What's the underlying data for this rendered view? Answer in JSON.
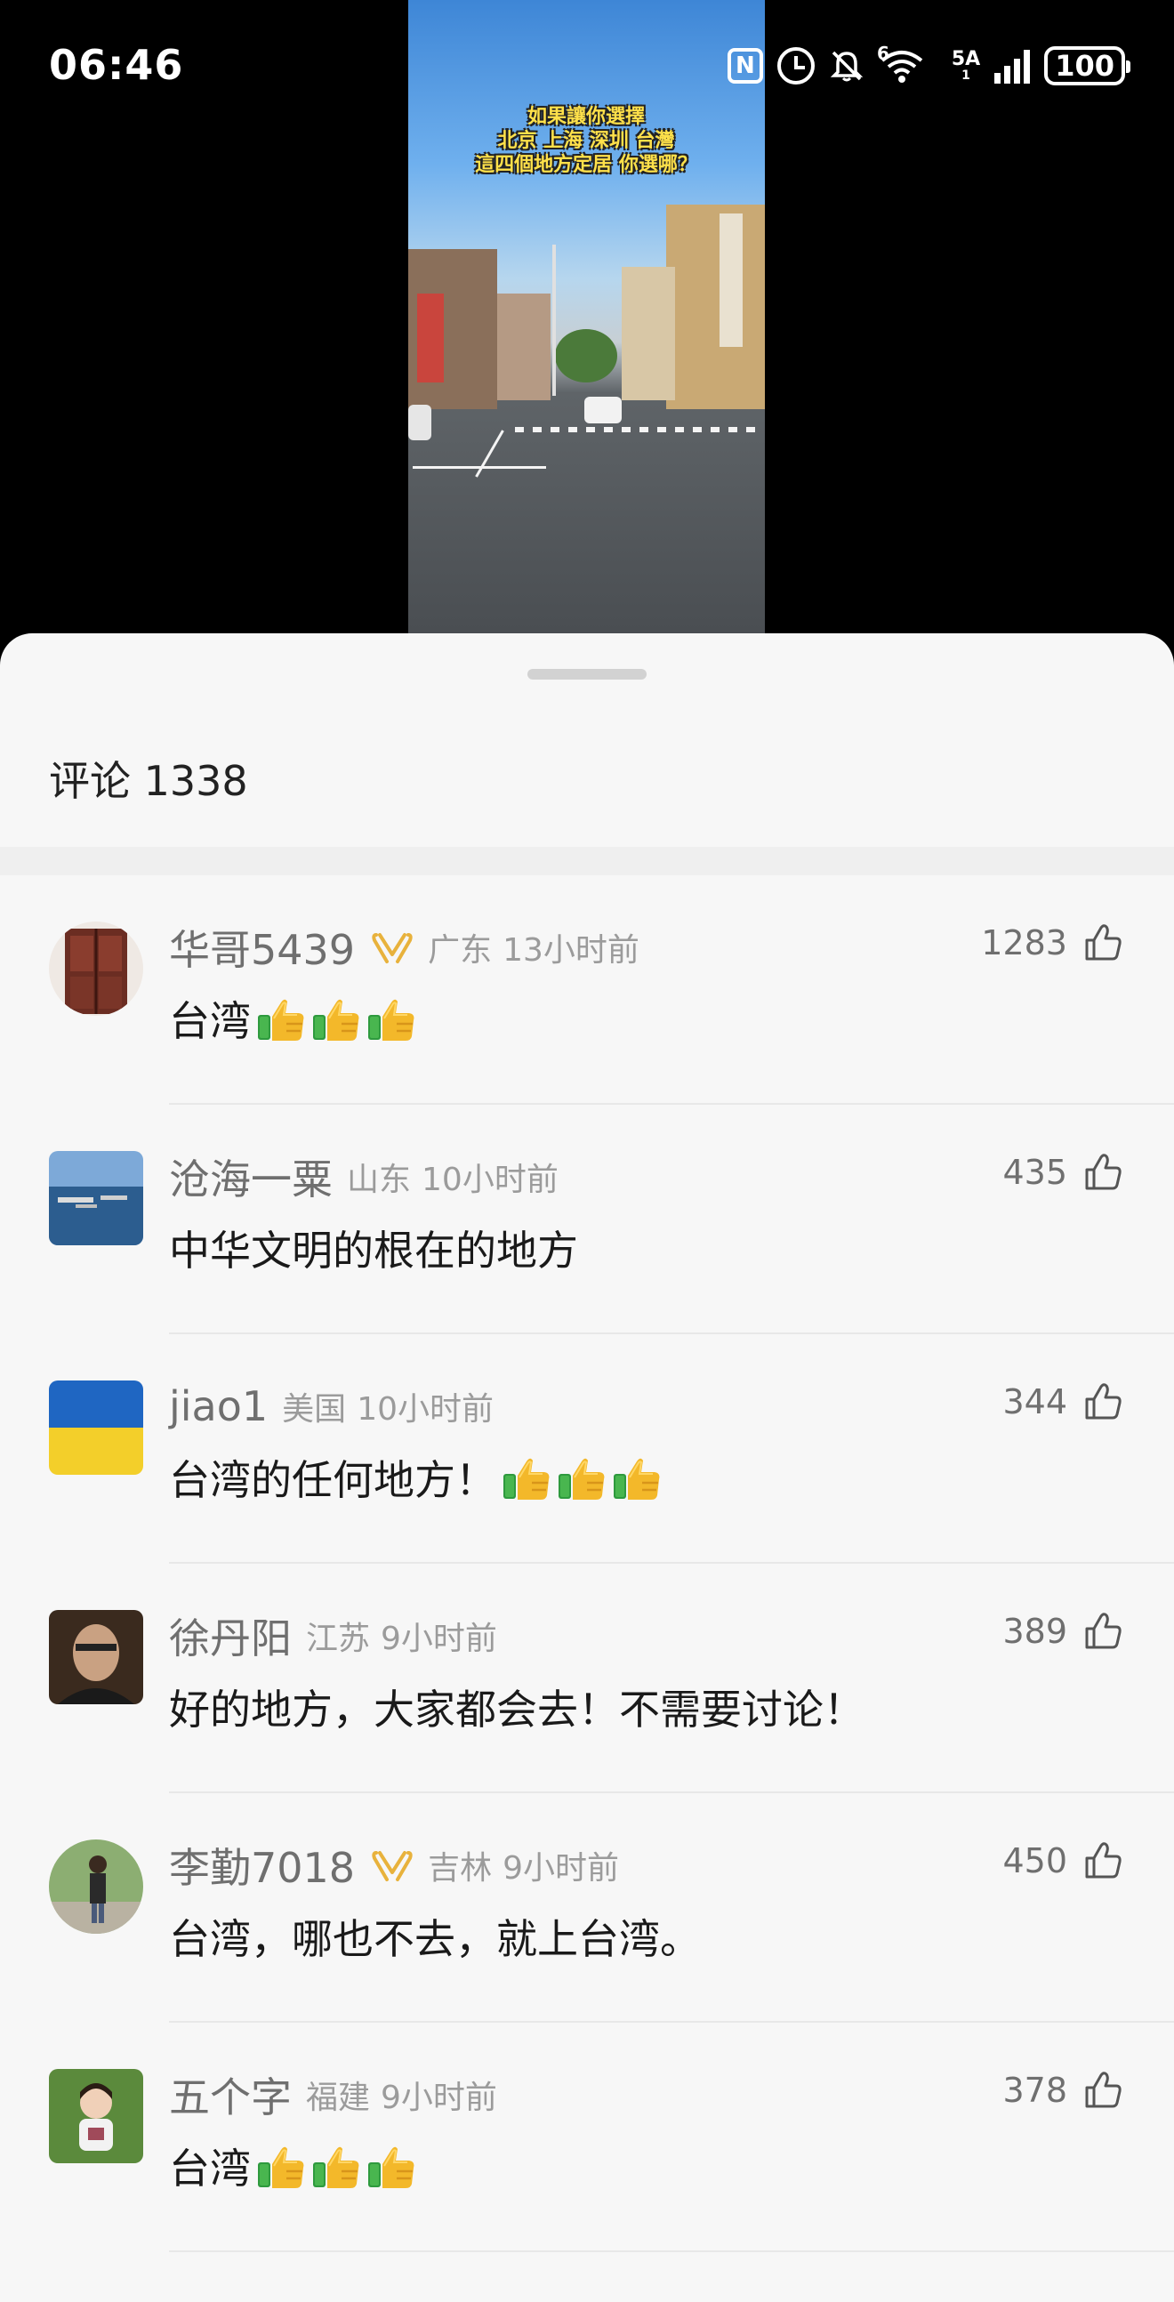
{
  "status_bar": {
    "time": "06:46",
    "network_label": "5A",
    "network_sub": "1",
    "wifi_label": "6",
    "battery": "100"
  },
  "video": {
    "caption_lines": [
      "如果讓你選擇",
      "北京 上海 深圳 台灣",
      "這四個地方定居 你選哪？"
    ]
  },
  "comments_header": {
    "label": "评论 1338"
  },
  "comments": [
    {
      "username": "华哥5439",
      "badge": true,
      "location": "广东",
      "time_ago": "13小时前",
      "likes": "1283",
      "text": "台湾",
      "thumbs": 3,
      "avatar": "wood-door"
    },
    {
      "username": "沧海一粟",
      "badge": false,
      "location": "山东",
      "time_ago": "10小时前",
      "likes": "435",
      "text": "中华文明的根在的地方",
      "thumbs": 0,
      "avatar": "sea-ships"
    },
    {
      "username": "jiao1",
      "badge": false,
      "location": "美国",
      "time_ago": "10小时前",
      "likes": "344",
      "text": "台湾的任何地方！",
      "thumbs": 3,
      "avatar": "ukraine-flag"
    },
    {
      "username": "徐丹阳",
      "badge": false,
      "location": "江苏",
      "time_ago": "9小时前",
      "likes": "389",
      "text": "好的地方，大家都会去！不需要讨论！",
      "thumbs": 0,
      "avatar": "man-portrait"
    },
    {
      "username": "李勤7018",
      "badge": true,
      "location": "吉林",
      "time_ago": "9小时前",
      "likes": "450",
      "text": "台湾，哪也不去，就上台湾。",
      "thumbs": 0,
      "avatar": "person-outdoor"
    },
    {
      "username": "五个字",
      "badge": false,
      "location": "福建",
      "time_ago": "9小时前",
      "likes": "378",
      "text": "台湾",
      "thumbs": 3,
      "avatar": "child-grass"
    }
  ],
  "colors": {
    "sheet_bg": "#f7f7f7",
    "badge": "#e8b23c",
    "username": "#6f6f6f",
    "meta": "#9b9b9b"
  }
}
